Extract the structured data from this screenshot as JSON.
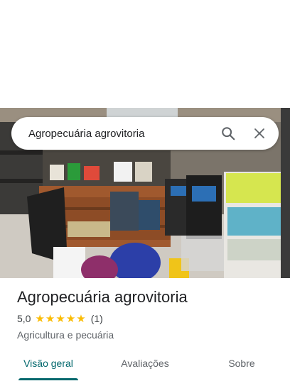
{
  "search": {
    "query": "Agropecuária agrovitoria",
    "icon_search": "search-icon",
    "icon_close": "close-icon"
  },
  "place": {
    "name": "Agropecuária agrovitoria",
    "rating": "5,0",
    "stars": 5,
    "review_count": "(1)",
    "category": "Agricultura e pecuária"
  },
  "tabs": [
    {
      "label": "Visão geral",
      "active": true
    },
    {
      "label": "Avaliações",
      "active": false
    },
    {
      "label": "Sobre",
      "active": false
    }
  ],
  "colors": {
    "accent": "#01676c",
    "star": "#fbbc04"
  }
}
